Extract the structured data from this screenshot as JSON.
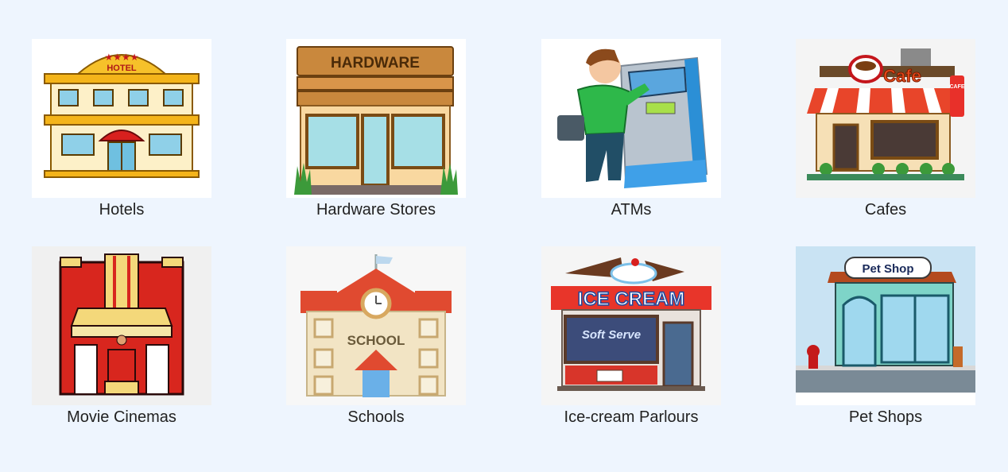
{
  "categories": [
    {
      "label": "Hotels",
      "icon": "hotel-icon",
      "sign": "HOTEL"
    },
    {
      "label": "Hardware Stores",
      "icon": "hardware-store-icon",
      "sign": "HARDWARE"
    },
    {
      "label": "ATMs",
      "icon": "atm-icon"
    },
    {
      "label": "Cafes",
      "icon": "cafe-icon",
      "sign": "Cafe",
      "side_sign": "CAFE"
    },
    {
      "label": "Movie Cinemas",
      "icon": "cinema-icon"
    },
    {
      "label": "Schools",
      "icon": "school-icon",
      "sign": "SCHOOL"
    },
    {
      "label": "Ice-cream Parlours",
      "icon": "ice-cream-parlour-icon",
      "sign": "ICE CREAM",
      "window_sign": "Soft Serve"
    },
    {
      "label": "Pet Shops",
      "icon": "pet-shop-icon",
      "sign": "Pet Shop"
    }
  ],
  "colors": {
    "background": "#eef5fe",
    "label": "#222222"
  }
}
